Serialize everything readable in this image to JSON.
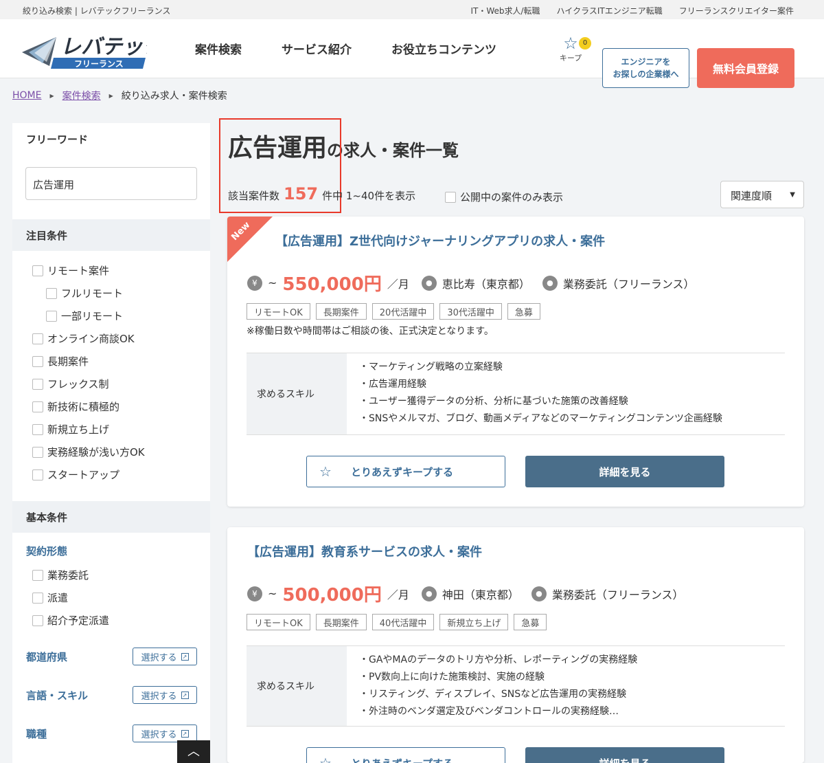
{
  "topbar": {
    "site_label": "絞り込み検索 | レバテックフリーランス",
    "links": [
      "IT・Web求人/転職",
      "ハイクラスITエンジニア転職",
      "フリーランスクリエイター案件"
    ]
  },
  "header": {
    "logo_main": "レバテック",
    "logo_sub": "フリーランス",
    "nav": [
      "案件検索",
      "サービス紹介",
      "お役立ちコンテンツ"
    ],
    "keep_label": "キープ",
    "keep_count": "0",
    "enterprise_line1": "エンジニアを",
    "enterprise_line2": "お探しの企業様へ",
    "register_label": "無料会員登録"
  },
  "breadcrumb": [
    "HOME",
    "案件検索",
    "絞り込み求人・案件検索"
  ],
  "sidebar": {
    "freeword_title": "フリーワード",
    "freeword_value": "広告運用",
    "featured_title": "注目条件",
    "featured": [
      {
        "label": "リモート案件",
        "indent": false
      },
      {
        "label": "フルリモート",
        "indent": true
      },
      {
        "label": "一部リモート",
        "indent": true
      },
      {
        "label": "オンライン商談OK",
        "indent": false
      },
      {
        "label": "長期案件",
        "indent": false
      },
      {
        "label": "フレックス制",
        "indent": false
      },
      {
        "label": "新技術に積極的",
        "indent": false
      },
      {
        "label": "新規立ち上げ",
        "indent": false
      },
      {
        "label": "実務経験が浅い方OK",
        "indent": false
      },
      {
        "label": "スタートアップ",
        "indent": false
      }
    ],
    "basic_title": "基本条件",
    "contract_title": "契約形態",
    "contract": [
      "業務委託",
      "派遣",
      "紹介予定派遣"
    ],
    "select_rows": [
      "都道府県",
      "言語・スキル",
      "職種"
    ],
    "select_label": "選択する"
  },
  "main": {
    "keyword": "広告運用",
    "title_suffix": "の求人・案件一覧",
    "count_prefix": "該当案件数",
    "count": "157",
    "count_suffix": "件中 1~40件を表示",
    "public_only": "公開中の案件のみ表示",
    "sort": "関連度順"
  },
  "jobs": [
    {
      "new": "New",
      "title": "【広告運用】Z世代向けジャーナリングアプリの求人・案件",
      "price_prefix": "~",
      "price": "550,000円",
      "unit": "／月",
      "location": "恵比寿（東京都）",
      "contract": "業務委託（フリーランス）",
      "tags": [
        "リモートOK",
        "長期案件",
        "20代活躍中",
        "30代活躍中",
        "急募"
      ],
      "note": "※稼働日数や時間帯はご相談の後、正式決定となります。",
      "skills_label": "求めるスキル",
      "skills": [
        "・マーケティング戦略の立案経験",
        "・広告運用経験",
        "・ユーザー獲得データの分析、分析に基づいた施策の改善経験",
        "・SNSやメルマガ、ブログ、動画メディアなどのマーケティングコンテンツ企画経験"
      ],
      "keep_label": "とりあえずキープする",
      "detail_label": "詳細を見る"
    },
    {
      "title": "【広告運用】教育系サービスの求人・案件",
      "price_prefix": "~",
      "price": "500,000円",
      "unit": "／月",
      "location": "神田（東京都）",
      "contract": "業務委託（フリーランス）",
      "tags": [
        "リモートOK",
        "長期案件",
        "40代活躍中",
        "新規立ち上げ",
        "急募"
      ],
      "skills_label": "求めるスキル",
      "skills": [
        "・GAやMAのデータのトリ方や分析、レポーティングの実務経験",
        "・PV数向上に向けた施策検討、実施の経験",
        "・リスティング、ディスプレイ、SNSなど広告運用の実務経験",
        "・外注時のベンダ選定及びベンダコントロールの実務経験…"
      ],
      "keep_label": "とりあえずキープする",
      "detail_label": "詳細を見る"
    }
  ]
}
